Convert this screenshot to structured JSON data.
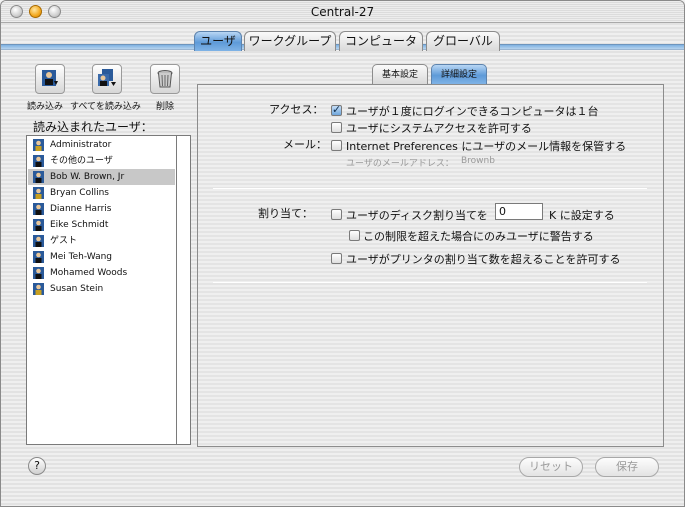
{
  "window": {
    "title": "Central-27"
  },
  "top_tabs": [
    {
      "label": "ユーザ",
      "active": true
    },
    {
      "label": "ワークグループ",
      "active": false
    },
    {
      "label": "コンピュータ",
      "active": false
    },
    {
      "label": "グローバル",
      "active": false
    }
  ],
  "toolbar": {
    "load_label": "読み込み",
    "load_all_label": "すべてを読み込み",
    "delete_label": "削除"
  },
  "sidebar": {
    "loaded_users_label": "読み込まれたユーザ：",
    "users": [
      {
        "name": "Administrator",
        "icon": "admin-user-icon"
      },
      {
        "name": "その他のユーザ",
        "icon": "user-icon"
      },
      {
        "name": "Bob W. Brown, Jr",
        "icon": "user-icon",
        "selected": true
      },
      {
        "name": "Bryan Collins",
        "icon": "admin-user-icon"
      },
      {
        "name": "Dianne Harris",
        "icon": "user-icon"
      },
      {
        "name": "Eike Schmidt",
        "icon": "user-icon"
      },
      {
        "name": "ゲスト",
        "icon": "user-icon"
      },
      {
        "name": "Mei Teh-Wang",
        "icon": "user-icon"
      },
      {
        "name": "Mohamed Woods",
        "icon": "user-icon"
      },
      {
        "name": "Susan Stein",
        "icon": "admin-user-icon"
      }
    ]
  },
  "sub_tabs": [
    {
      "label": "基本設定",
      "active": false
    },
    {
      "label": "詳細設定",
      "active": true
    }
  ],
  "settings": {
    "access_label": "アクセス：",
    "access_opt1": "ユーザが１度にログインできるコンピュータは１台",
    "access_opt1_checked": true,
    "access_opt2": "ユーザにシステムアクセスを許可する",
    "access_opt2_checked": false,
    "mail_label": "メール：",
    "mail_opt": "Internet Preferences にユーザのメール情報を保管する",
    "mail_opt_checked": false,
    "mail_address_label": "ユーザのメールアドレス：",
    "mail_address_value": "Brownb",
    "quota_label": "割り当て：",
    "quota_opt_pre": "ユーザのディスク割り当てを",
    "quota_value": "0",
    "quota_opt_post": "K に設定する",
    "warn_opt": "この制限を超えた場合にのみユーザに警告する",
    "printer_opt": "ユーザがプリンタの割り当て数を超えることを許可する"
  },
  "footer": {
    "help_label": "?",
    "revert_label": "リセット",
    "save_label": "保存"
  }
}
